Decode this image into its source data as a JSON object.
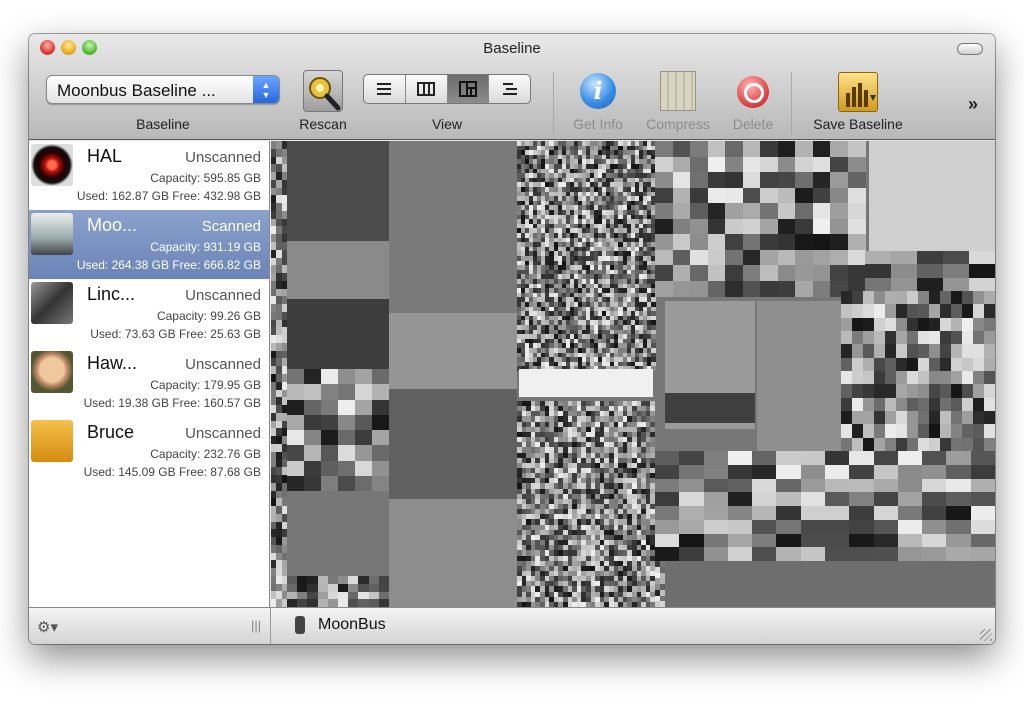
{
  "window": {
    "title": "Baseline"
  },
  "toolbar": {
    "baseline_popup_value": "Moonbus Baseline ...",
    "baseline_label": "Baseline",
    "rescan_label": "Rescan",
    "view_label": "View",
    "get_info_label": "Get Info",
    "compress_label": "Compress",
    "delete_label": "Delete",
    "save_baseline_label": "Save Baseline",
    "view_modes": [
      "list-view-icon",
      "column-view-icon",
      "treemap-view-icon",
      "outline-view-icon"
    ],
    "active_view_mode": "treemap-view-icon"
  },
  "sidebar": {
    "selected_index": 1,
    "drives": [
      {
        "name": "HAL",
        "status": "Unscanned",
        "capacity": "Capacity: 595.85 GB",
        "usage": "Used: 162.87 GB Free: 432.98 GB",
        "icon": "hal-eye-icon"
      },
      {
        "name": "Moo...",
        "status": "Scanned",
        "capacity": "Capacity: 931.19 GB",
        "usage": "Used: 264.38 GB Free: 666.82 GB",
        "icon": "moonbus-icon"
      },
      {
        "name": "Linc...",
        "status": "Unscanned",
        "capacity": "Capacity: 99.26 GB",
        "usage": "Used: 73.63 GB Free: 25.63 GB",
        "icon": "lincoln-portrait-icon"
      },
      {
        "name": "Haw...",
        "status": "Unscanned",
        "capacity": "Capacity: 179.95 GB",
        "usage": "Used: 19.38 GB Free: 160.57 GB",
        "icon": "hawking-portrait-icon"
      },
      {
        "name": "Bruce",
        "status": "Unscanned",
        "capacity": "Capacity: 232.76 GB",
        "usage": "Used: 145.09 GB Free: 87.68 GB",
        "icon": "usb-drive-icon"
      }
    ]
  },
  "bottom_bar": {
    "path_label": "MoonBus"
  },
  "colors": {
    "selection": "#7b93c4",
    "info_blue": "#3b8fe6",
    "delete_red": "#e04a4a"
  }
}
